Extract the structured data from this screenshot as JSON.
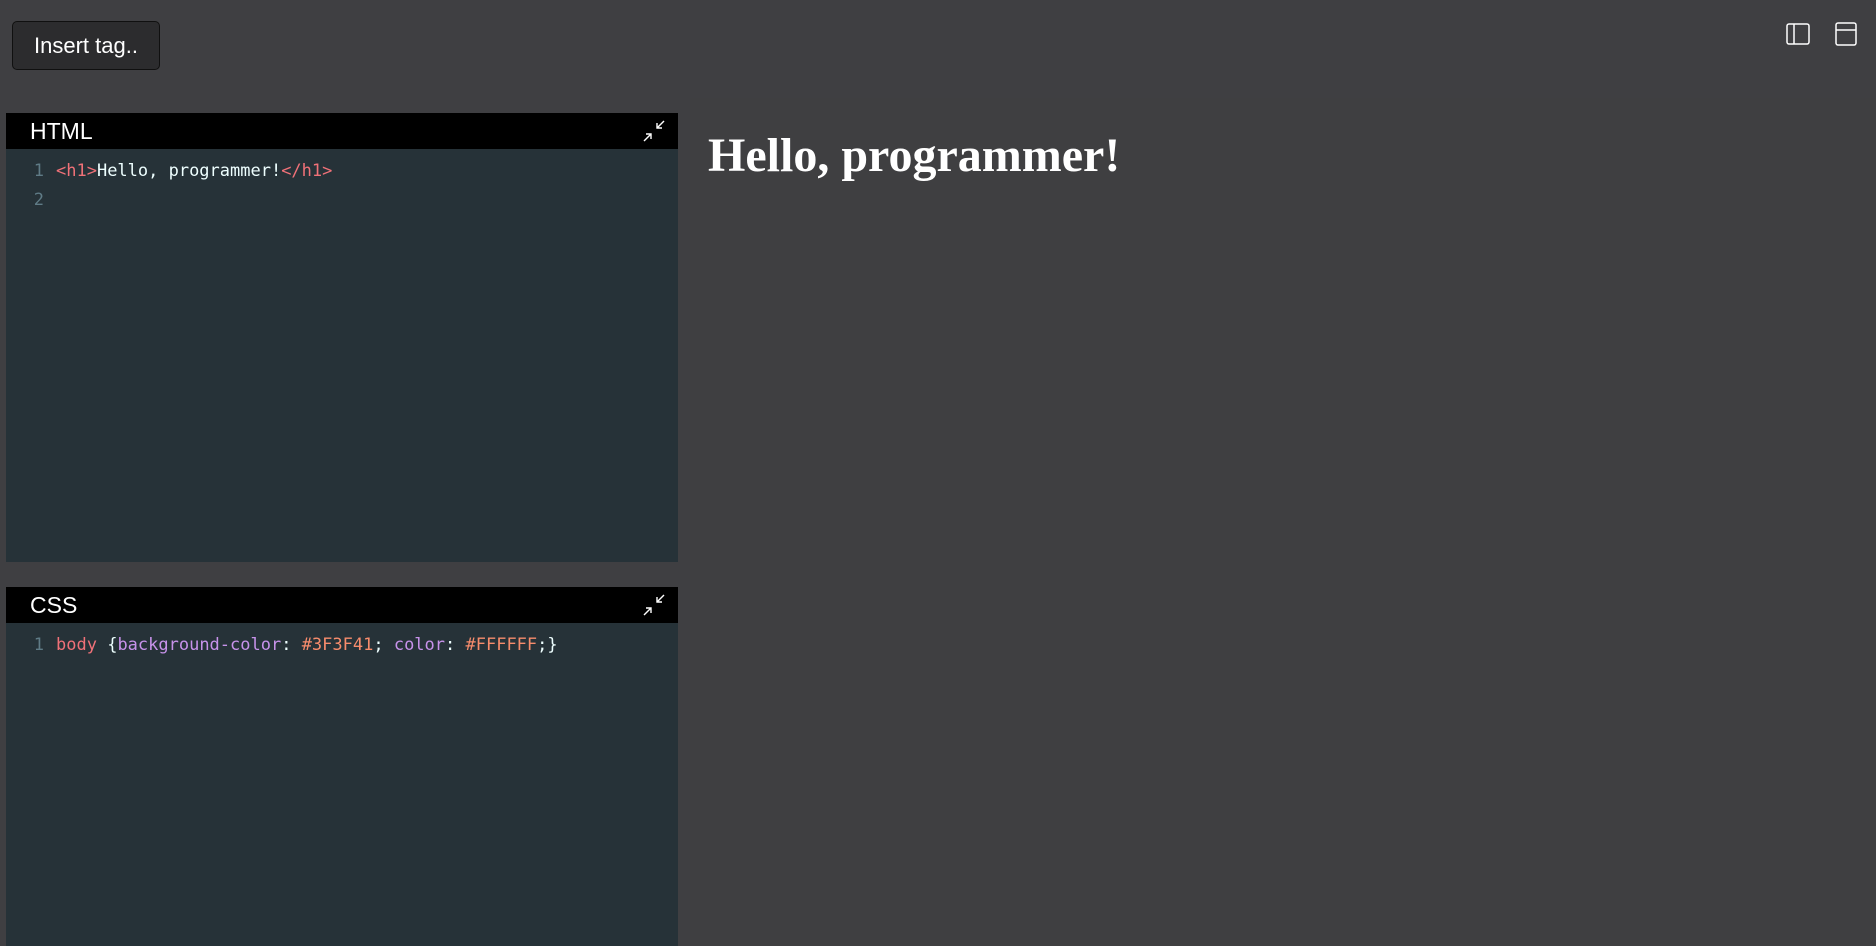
{
  "toolbar": {
    "insert_tag_label": "Insert tag.."
  },
  "icons": {
    "layout_left": "sidebar-left-icon",
    "layout_top": "panel-top-icon",
    "collapse": "collapse-arrows-icon"
  },
  "editors": {
    "html": {
      "title": "HTML",
      "lines": [
        {
          "number": "1",
          "tokens": [
            {
              "type": "tag",
              "text": "<h1>"
            },
            {
              "type": "text",
              "text": "Hello, programmer!"
            },
            {
              "type": "tag",
              "text": "</h1>"
            }
          ]
        },
        {
          "number": "2",
          "tokens": []
        }
      ]
    },
    "css": {
      "title": "CSS",
      "lines": [
        {
          "number": "1",
          "tokens": [
            {
              "type": "sel",
              "text": "body"
            },
            {
              "type": "punc",
              "text": " {"
            },
            {
              "type": "prop",
              "text": "background-color"
            },
            {
              "type": "punc",
              "text": ": "
            },
            {
              "type": "val",
              "text": "#3F3F41"
            },
            {
              "type": "punc",
              "text": "; "
            },
            {
              "type": "prop",
              "text": "color"
            },
            {
              "type": "punc",
              "text": ": "
            },
            {
              "type": "val",
              "text": "#FFFFFF"
            },
            {
              "type": "punc",
              "text": ";}"
            }
          ]
        }
      ]
    }
  },
  "preview": {
    "heading": "Hello, programmer!"
  },
  "colors": {
    "app_background": "#3f3f42",
    "editor_background": "#263238",
    "header_background": "#000000",
    "tag": "#f07178",
    "property": "#c792ea",
    "value": "#f78c6c",
    "text": "#eeffff",
    "line_number": "#5f7b86"
  }
}
